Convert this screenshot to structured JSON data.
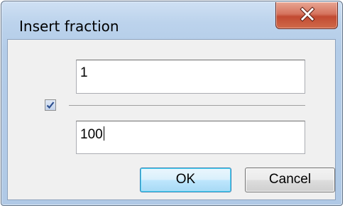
{
  "window": {
    "title": "Insert fraction",
    "close_icon": "close-x-icon"
  },
  "form": {
    "numerator_value": "1",
    "denominator_value": "100",
    "checkbox_checked": true,
    "checkbox_icon": "check-icon"
  },
  "buttons": {
    "ok_label": "OK",
    "cancel_label": "Cancel"
  }
}
